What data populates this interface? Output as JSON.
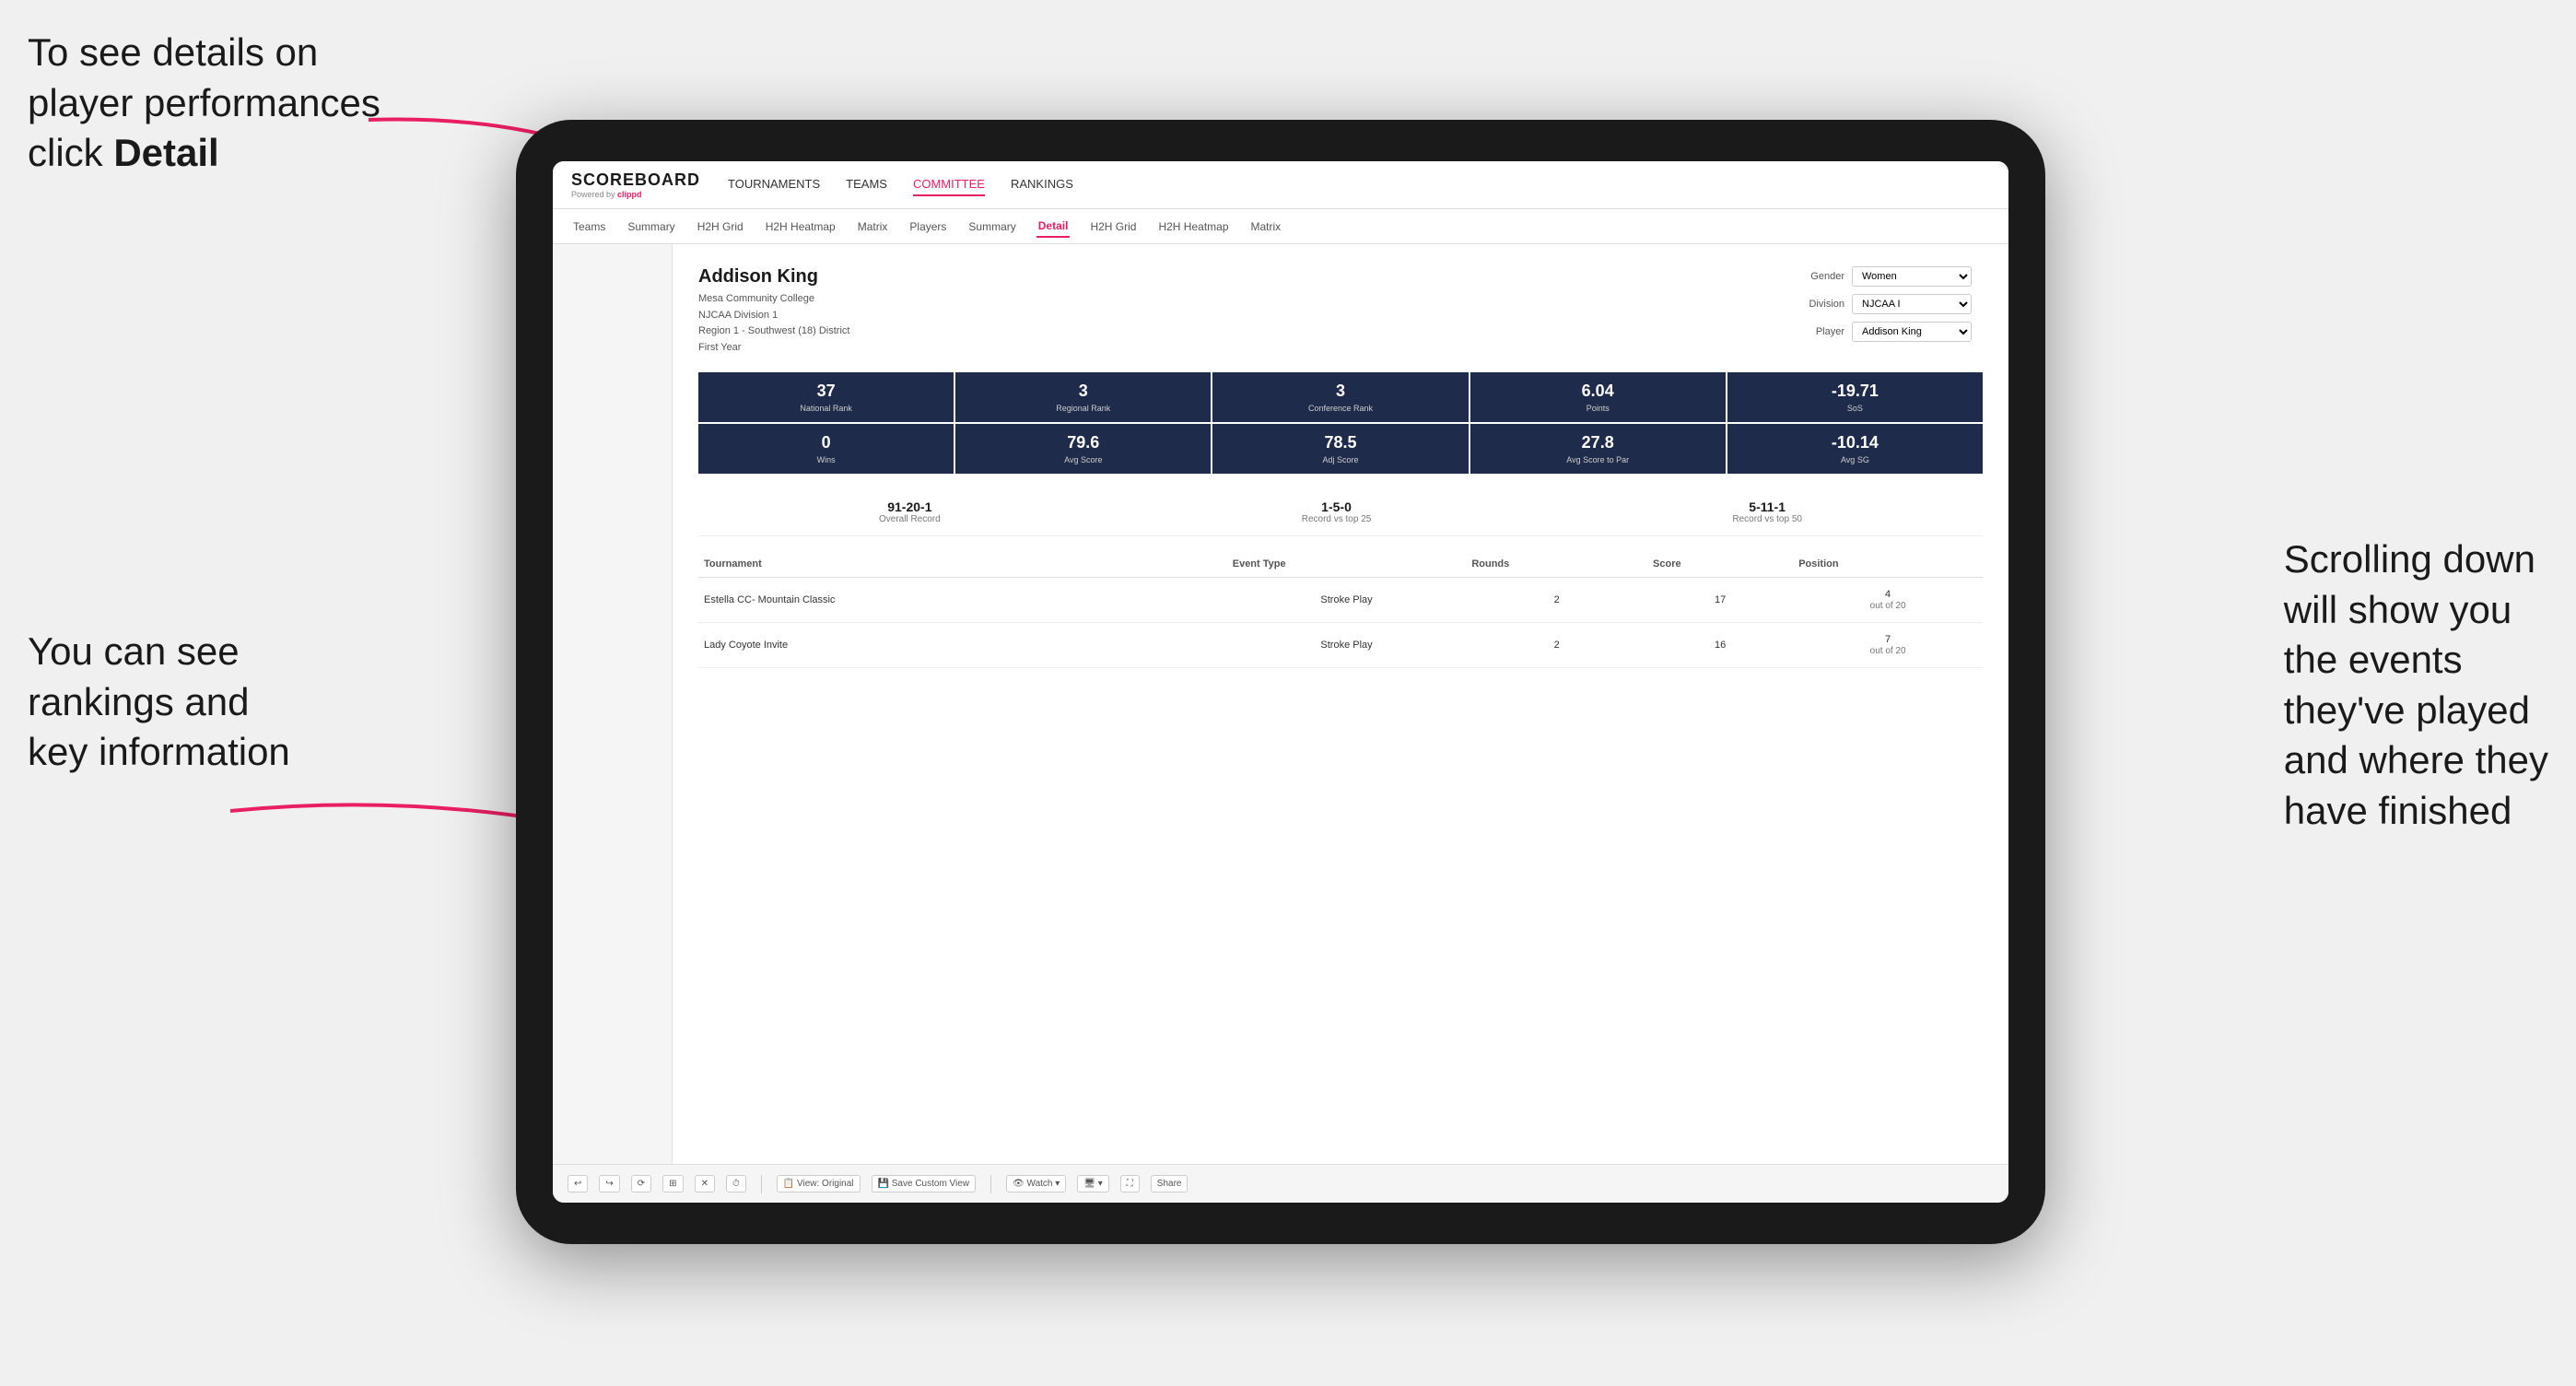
{
  "annotations": {
    "top_left": "To see details on\nplayer performances\nclick Detail",
    "bottom_left": "You can see\nrankings and\nkey information",
    "bottom_right": "Scrolling down\nwill show you\nthe events\nthey've played\nand where they\nhave finished"
  },
  "app": {
    "logo": "SCOREBOARD",
    "logo_sub": "Powered by clippd",
    "nav_items": [
      "TOURNAMENTS",
      "TEAMS",
      "COMMITTEE",
      "RANKINGS"
    ],
    "active_nav": "COMMITTEE"
  },
  "sub_nav": {
    "items": [
      "Teams",
      "Summary",
      "H2H Grid",
      "H2H Heatmap",
      "Matrix",
      "Players",
      "Summary",
      "Detail",
      "H2H Grid",
      "H2H Heatmap",
      "Matrix"
    ],
    "active": "Detail"
  },
  "player": {
    "name": "Addison King",
    "college": "Mesa Community College",
    "division": "NJCAA Division 1",
    "region": "Region 1 - Southwest (18) District",
    "year": "First Year",
    "gender_label": "Gender",
    "gender_value": "Women",
    "division_label": "Division",
    "division_value": "NJCAA I",
    "player_label": "Player",
    "player_value": "Addison King"
  },
  "stats_row1": [
    {
      "value": "37",
      "label": "National Rank"
    },
    {
      "value": "3",
      "label": "Regional Rank"
    },
    {
      "value": "3",
      "label": "Conference Rank"
    },
    {
      "value": "6.04",
      "label": "Points"
    },
    {
      "value": "-19.71",
      "label": "SoS"
    }
  ],
  "stats_row2": [
    {
      "value": "0",
      "label": "Wins"
    },
    {
      "value": "79.6",
      "label": "Avg Score"
    },
    {
      "value": "78.5",
      "label": "Adj Score"
    },
    {
      "value": "27.8",
      "label": "Avg Score to Par"
    },
    {
      "value": "-10.14",
      "label": "Avg SG"
    }
  ],
  "records": [
    {
      "value": "91-20-1",
      "label": "Overall Record"
    },
    {
      "value": "1-5-0",
      "label": "Record vs top 25"
    },
    {
      "value": "5-11-1",
      "label": "Record vs top 50"
    }
  ],
  "table": {
    "headers": [
      "Tournament",
      "Event Type",
      "Rounds",
      "Score",
      "Position"
    ],
    "rows": [
      {
        "tournament": "Estella CC- Mountain Classic",
        "event_type": "Stroke Play",
        "rounds": "2",
        "score": "17",
        "position": "4\nout of 20"
      },
      {
        "tournament": "Lady Coyote Invite",
        "event_type": "Stroke Play",
        "rounds": "2",
        "score": "16",
        "position": "7\nout of 20"
      }
    ]
  },
  "toolbar": {
    "buttons": [
      "↩",
      "↪",
      "⟳",
      "⊞",
      "✕",
      "⏱",
      "View: Original",
      "Save Custom View",
      "Watch ▾",
      "🖥 ▾",
      "⛶",
      "Share"
    ]
  }
}
